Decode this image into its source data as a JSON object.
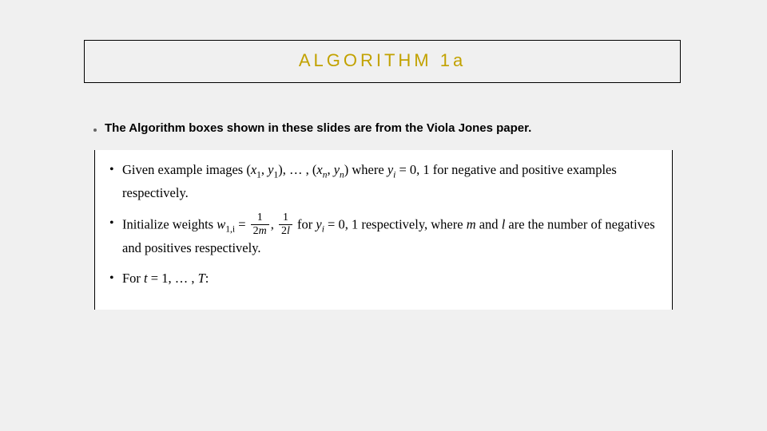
{
  "slide": {
    "title": "ALGORITHM 1a",
    "bullet": "The Algorithm boxes shown in these slides are from the Viola Jones paper.",
    "algo": {
      "item1_pre": "Given example images ",
      "item1_pair1_open": "(",
      "item1_x1": "x",
      "item1_x1_sub": "1",
      "item1_c1": ", ",
      "item1_y1": "y",
      "item1_y1_sub": "1",
      "item1_pair1_close": "), … , (",
      "item1_xn": "x",
      "item1_xn_sub": "n",
      "item1_c2": ", ",
      "item1_yn": "y",
      "item1_yn_sub": "n",
      "item1_pair2_close": ") ",
      "item1_where": "where ",
      "item1_yi": "y",
      "item1_yi_sub": "i",
      "item1_eq": " = 0, 1 ",
      "item1_tail": "for negative and positive examples respectively.",
      "item2_pre": "Initialize weights ",
      "item2_w": "w",
      "item2_w_sub": "1,i",
      "item2_eq": " = ",
      "item2_f1_num": "1",
      "item2_f1_den_pre": "2",
      "item2_f1_den_m": "m",
      "item2_comma": ", ",
      "item2_f2_num": "1",
      "item2_f2_den_pre": "2",
      "item2_f2_den_l": "l",
      "item2_for": " for ",
      "item2_yi": "y",
      "item2_yi_sub": "i",
      "item2_eq2": " = 0, 1 respectively, where ",
      "item2_m": "m",
      "item2_and": " and ",
      "item2_l": "l",
      "item2_tail": " are the number of negatives and positives respectively.",
      "item3_pre": "For ",
      "item3_t": "t",
      "item3_eq": " = 1, … , ",
      "item3_T": "T",
      "item3_colon": ":"
    }
  }
}
